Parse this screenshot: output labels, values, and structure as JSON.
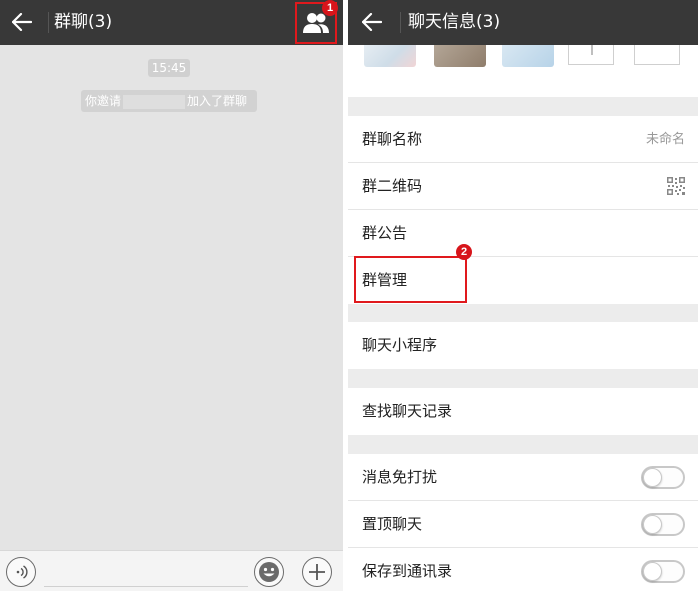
{
  "left": {
    "title": "群聊(3)",
    "badge": "1",
    "time_chip": "15:45",
    "system_message": {
      "prefix": "你邀请",
      "suffix": "加入了群聊"
    }
  },
  "right": {
    "title": "聊天信息(3)",
    "badge": "2",
    "group_name": {
      "label": "群聊名称",
      "value": "未命名"
    },
    "qr_code": {
      "label": "群二维码"
    },
    "announcement": {
      "label": "群公告"
    },
    "management": {
      "label": "群管理"
    },
    "mini_program": {
      "label": "聊天小程序"
    },
    "search_history": {
      "label": "查找聊天记录"
    },
    "mute": {
      "label": "消息免打扰",
      "on": false
    },
    "sticky": {
      "label": "置顶聊天",
      "on": false
    },
    "save_contacts": {
      "label": "保存到通讯录",
      "on": false
    }
  },
  "colors": {
    "topbar": "#383838",
    "highlight": "#e0191d",
    "badge": "#d7151b"
  },
  "icons": {
    "back": "arrow-left-icon",
    "members": "group-members-icon",
    "voice": "voice-icon",
    "emoji": "emoji-icon",
    "more": "plus-icon",
    "qr": "qr-code-icon"
  }
}
